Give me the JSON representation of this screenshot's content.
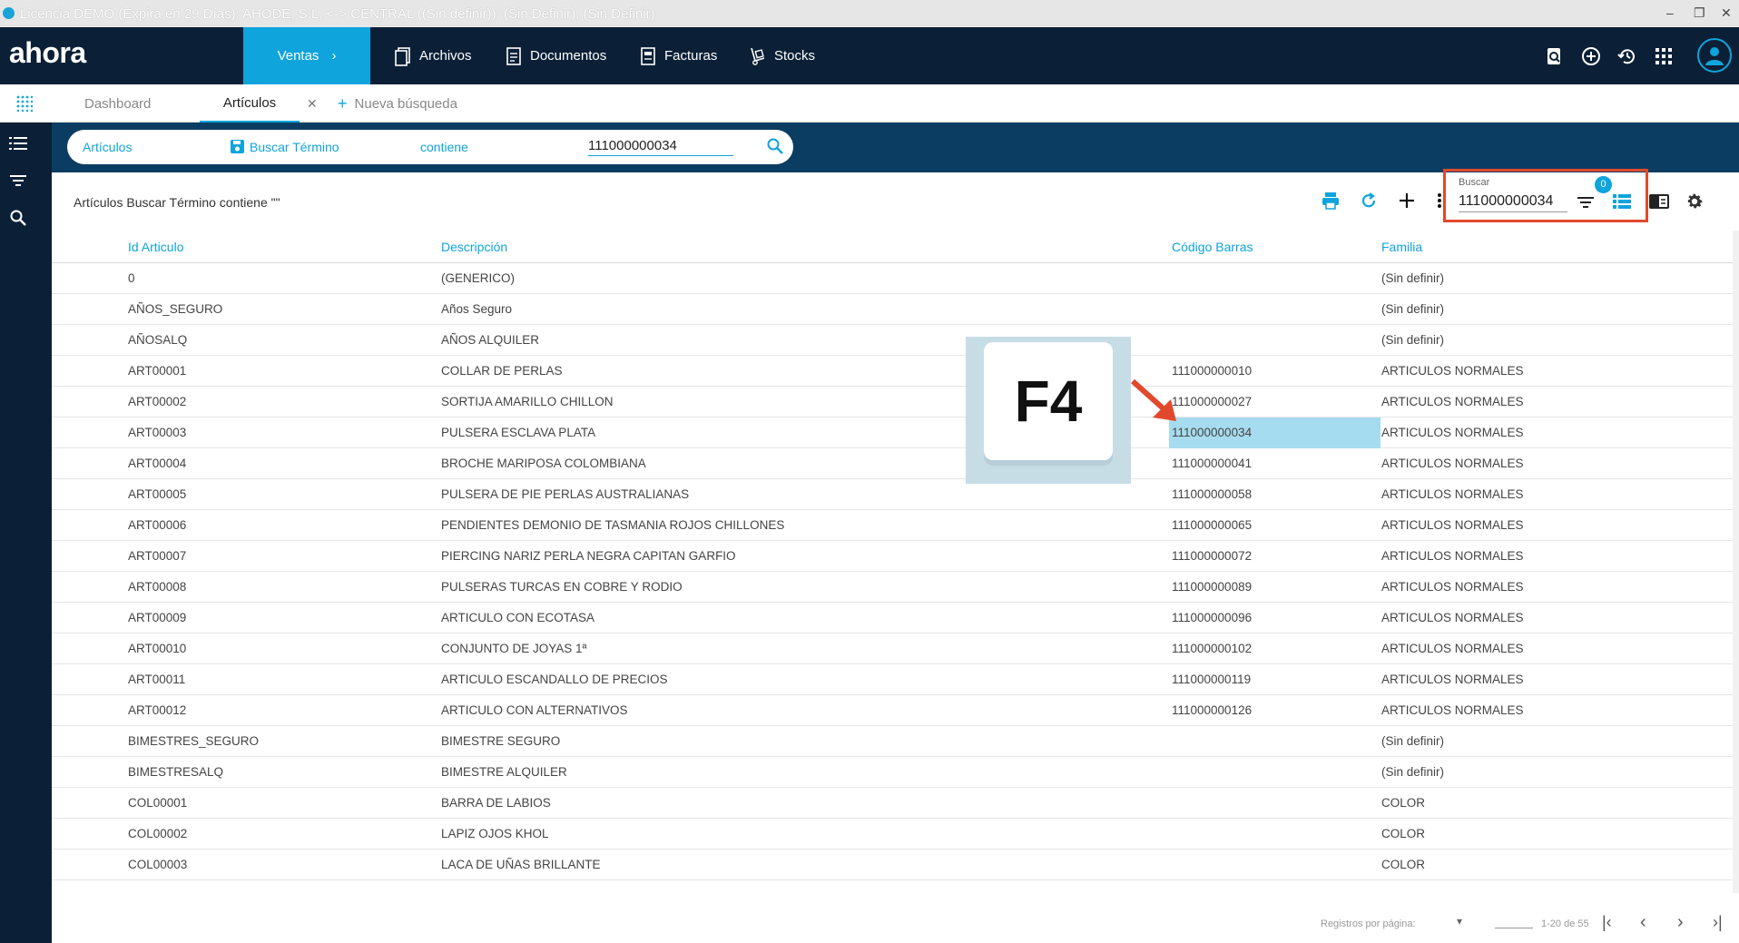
{
  "window": {
    "title": "Licencia DEMO (Expira en 29 Días): AHODE, S.L. <-> CENTRAL ((Sin definir)). (Sin Definir), (Sin Definir)"
  },
  "topnav": {
    "logo": "ahora",
    "active_item": "Ventas",
    "items": [
      "Archivos",
      "Documentos",
      "Facturas",
      "Stocks"
    ]
  },
  "tabs": {
    "items": [
      "Dashboard",
      "Artículos"
    ],
    "new_search": "Nueva búsqueda"
  },
  "search_bar": {
    "entity": "Artículos",
    "field": "Buscar Término",
    "operator": "contiene",
    "value": "111000000034"
  },
  "page": {
    "title": "Artículos Buscar Término contiene \"\""
  },
  "buscar": {
    "label": "Buscar",
    "value": "111000000034",
    "filter_count": "0"
  },
  "table": {
    "headers": [
      "Id Articulo",
      "Descripción",
      "Código Barras",
      "Familia"
    ],
    "rows": [
      [
        "0",
        "(GENERICO)",
        "",
        "(Sin definir)"
      ],
      [
        "AÑOS_SEGURO",
        "Años Seguro",
        "",
        "(Sin definir)"
      ],
      [
        "AÑOSALQ",
        "AÑOS ALQUILER",
        "",
        "(Sin definir)"
      ],
      [
        "ART00001",
        "COLLAR DE PERLAS",
        "111000000010",
        "ARTICULOS NORMALES"
      ],
      [
        "ART00002",
        "SORTIJA AMARILLO CHILLON",
        "111000000027",
        "ARTICULOS NORMALES"
      ],
      [
        "ART00003",
        "PULSERA ESCLAVA PLATA",
        "111000000034",
        "ARTICULOS NORMALES"
      ],
      [
        "ART00004",
        "BROCHE MARIPOSA COLOMBIANA",
        "111000000041",
        "ARTICULOS NORMALES"
      ],
      [
        "ART00005",
        "PULSERA DE PIE PERLAS AUSTRALIANAS",
        "111000000058",
        "ARTICULOS NORMALES"
      ],
      [
        "ART00006",
        "PENDIENTES DEMONIO DE TASMANIA ROJOS CHILLONES",
        "111000000065",
        "ARTICULOS NORMALES"
      ],
      [
        "ART00007",
        "PIERCING NARIZ PERLA NEGRA CAPITAN GARFIO",
        "111000000072",
        "ARTICULOS NORMALES"
      ],
      [
        "ART00008",
        "PULSERAS TURCAS EN COBRE Y RODIO",
        "111000000089",
        "ARTICULOS NORMALES"
      ],
      [
        "ART00009",
        "ARTICULO CON ECOTASA",
        "111000000096",
        "ARTICULOS NORMALES"
      ],
      [
        "ART00010",
        "CONJUNTO DE JOYAS 1ª",
        "111000000102",
        "ARTICULOS NORMALES"
      ],
      [
        "ART00011",
        "ARTICULO ESCANDALLO DE PRECIOS",
        "111000000119",
        "ARTICULOS NORMALES"
      ],
      [
        "ART00012",
        "ARTICULO CON ALTERNATIVOS",
        "111000000126",
        "ARTICULOS NORMALES"
      ],
      [
        "BIMESTRES_SEGURO",
        "BIMESTRE SEGURO",
        "",
        "(Sin definir)"
      ],
      [
        "BIMESTRESALQ",
        "BIMESTRE ALQUILER",
        "",
        "(Sin definir)"
      ],
      [
        "COL00001",
        "BARRA DE LABIOS",
        "",
        "COLOR"
      ],
      [
        "COL00002",
        "LAPIZ OJOS KHOL",
        "",
        "COLOR"
      ],
      [
        "COL00003",
        "LACA DE UÑAS BRILLANTE",
        "",
        "COLOR"
      ]
    ]
  },
  "pagination": {
    "label": "Registros por página:",
    "range": "1-20 de 55"
  },
  "overlay": {
    "key": "F4"
  },
  "colors": {
    "accent": "#0fa4dc",
    "navbar": "#0b2036",
    "highlight": "#a6dcef",
    "annotation": "#e1492d"
  }
}
